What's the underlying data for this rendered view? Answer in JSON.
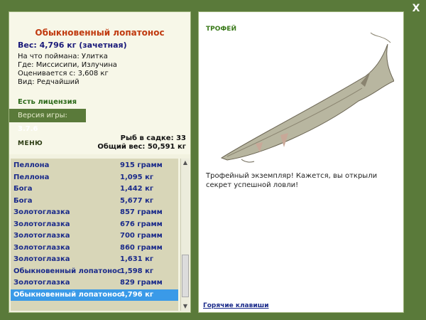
{
  "close_label": "X",
  "fish": {
    "title": "Обыкновенный лопатонос",
    "weight": "Вес: 4,796 кг (зачетная)",
    "bait": "На что поймана: Улитка",
    "location": "Где: Миссисипи, Излучина",
    "valued_from": "Оценивается с: 3,608 кг",
    "type": "Вид: Редчайший"
  },
  "license": "Есть лицензия",
  "version": {
    "label": "Версия игры:",
    "value": "3.7.6"
  },
  "menu_label": "МЕНЮ",
  "stats": {
    "count": "Рыб в садке: 33",
    "total": "Общий вес: 50,591 кг"
  },
  "catch_list": [
    {
      "name": "Пеллона",
      "weight": "915 грамм"
    },
    {
      "name": "Пеллона",
      "weight": "1,095 кг"
    },
    {
      "name": "Бога",
      "weight": "1,442 кг"
    },
    {
      "name": "Бога",
      "weight": "5,677 кг"
    },
    {
      "name": "Золотоглазка",
      "weight": "857 грамм"
    },
    {
      "name": "Золотоглазка",
      "weight": "676 грамм"
    },
    {
      "name": "Золотоглазка",
      "weight": "700 грамм"
    },
    {
      "name": "Золотоглазка",
      "weight": "860 грамм"
    },
    {
      "name": "Золотоглазка",
      "weight": "1,631 кг"
    },
    {
      "name": "Обыкновенный лопатонос",
      "weight": "1,598 кг"
    },
    {
      "name": "Золотоглазка",
      "weight": "829 грамм"
    },
    {
      "name": "Обыкновенный лопатонос",
      "weight": "4,796 кг",
      "selected": true
    }
  ],
  "trophy_label": "ТРОФЕЙ",
  "message": "Трофейный экземпляр! Кажется, вы открыли секрет успешной ловли!",
  "hotkeys_label": "Горячие клавиши"
}
